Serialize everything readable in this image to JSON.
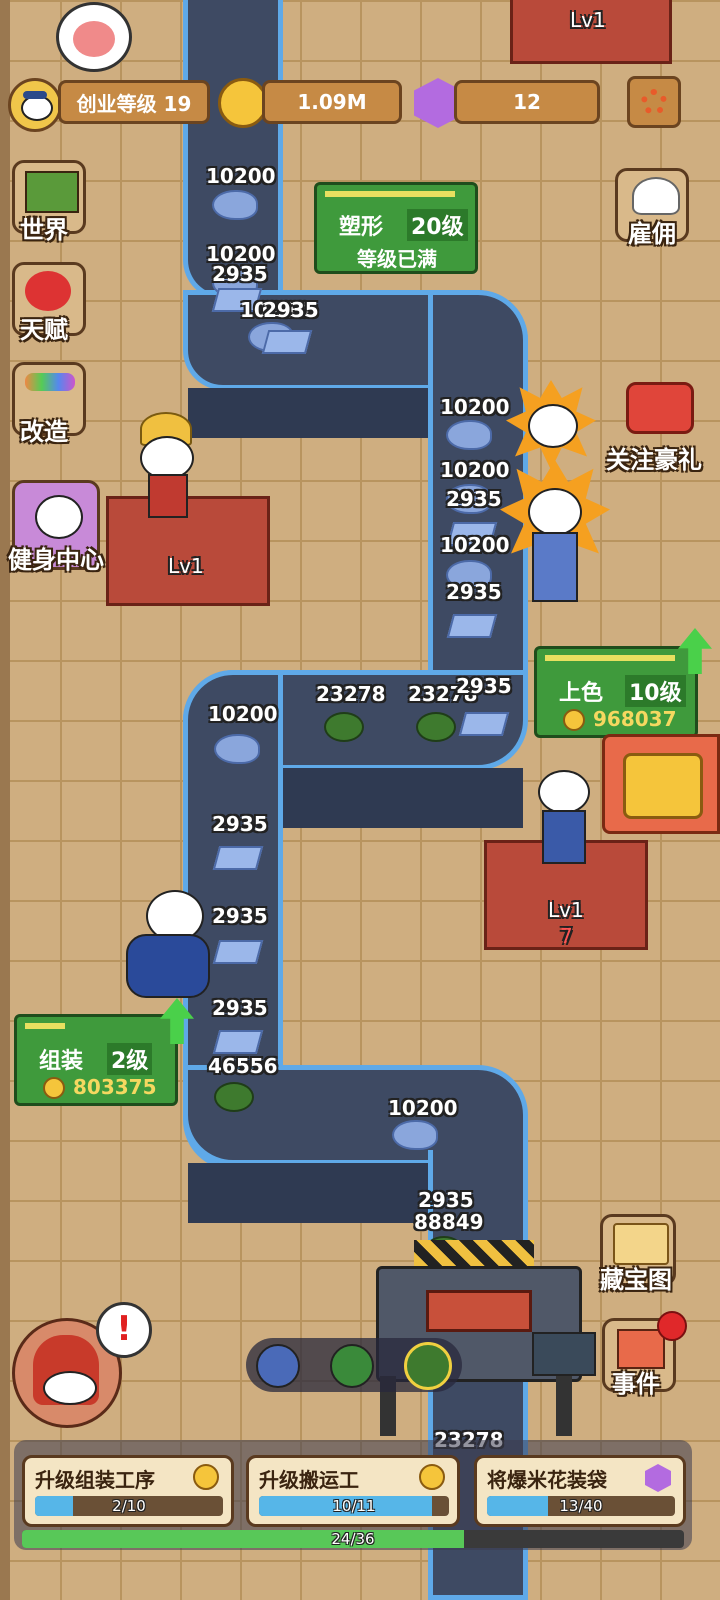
{
  "topbar": {
    "level_label": "创业等级 19",
    "coins": "1.09M",
    "gems": "12"
  },
  "side_left": {
    "world": "世界",
    "talent": "天赋",
    "remodel": "改造",
    "gym": "健身中心"
  },
  "side_right": {
    "hire": "雇佣",
    "follow_gift": "关注豪礼",
    "treasure_map": "藏宝图",
    "events": "事件"
  },
  "stations": {
    "molding": {
      "name": "塑形",
      "level": "20级",
      "status": "等级已满"
    },
    "coloring": {
      "name": "上色",
      "level": "10级",
      "cost": "968037"
    },
    "assembly": {
      "name": "组装",
      "level": "2级",
      "cost": "803375"
    },
    "worker_lv_1": "Lv1",
    "worker_lv_2": "Lv1",
    "worker_lv_3": "Lv1",
    "worker_count": "7"
  },
  "belt_items": [
    {
      "label": "10200",
      "kind": "rock"
    },
    {
      "label": "10200",
      "kind": "rock"
    },
    {
      "label": "2935",
      "kind": "plate"
    },
    {
      "label": "10200",
      "kind": "rock"
    },
    {
      "label": "2935",
      "kind": "plate"
    },
    {
      "label": "10200",
      "kind": "rock"
    },
    {
      "label": "10200",
      "kind": "rock"
    },
    {
      "label": "2935",
      "kind": "plate"
    },
    {
      "label": "10200",
      "kind": "rock"
    },
    {
      "label": "2935",
      "kind": "plate"
    },
    {
      "label": "23278",
      "kind": "turtle"
    },
    {
      "label": "23278",
      "kind": "turtle"
    },
    {
      "label": "2935",
      "kind": "plate"
    },
    {
      "label": "10200",
      "kind": "rock"
    },
    {
      "label": "2935",
      "kind": "plate"
    },
    {
      "label": "2935",
      "kind": "plate"
    },
    {
      "label": "2935",
      "kind": "plate"
    },
    {
      "label": "46556",
      "kind": "turtle"
    },
    {
      "label": "10200",
      "kind": "rock"
    },
    {
      "label": "2935",
      "kind": "plate"
    },
    {
      "label": "88849",
      "kind": "turtle"
    },
    {
      "label": "23278",
      "kind": "turtle"
    }
  ],
  "bottom": {
    "upgrade_assembly": {
      "label": "升级组装工序",
      "progress": "2/10",
      "fraction": 0.2
    },
    "upgrade_carrier": {
      "label": "升级搬运工",
      "progress": "10/11",
      "fraction": 0.909
    },
    "popcorn_bag": {
      "label": "将爆米花装袋",
      "progress": "13/40",
      "fraction": 0.325
    },
    "overall": {
      "progress": "24/36",
      "fraction": 0.667
    }
  },
  "colors": {
    "belt": "#3e4a63",
    "belt_border": "#5fa9e8",
    "panel_green": "#3f9a3c",
    "station_red": "#b94a3a",
    "coin_gold": "#f5c53b",
    "gem_purple": "#b36be0"
  }
}
